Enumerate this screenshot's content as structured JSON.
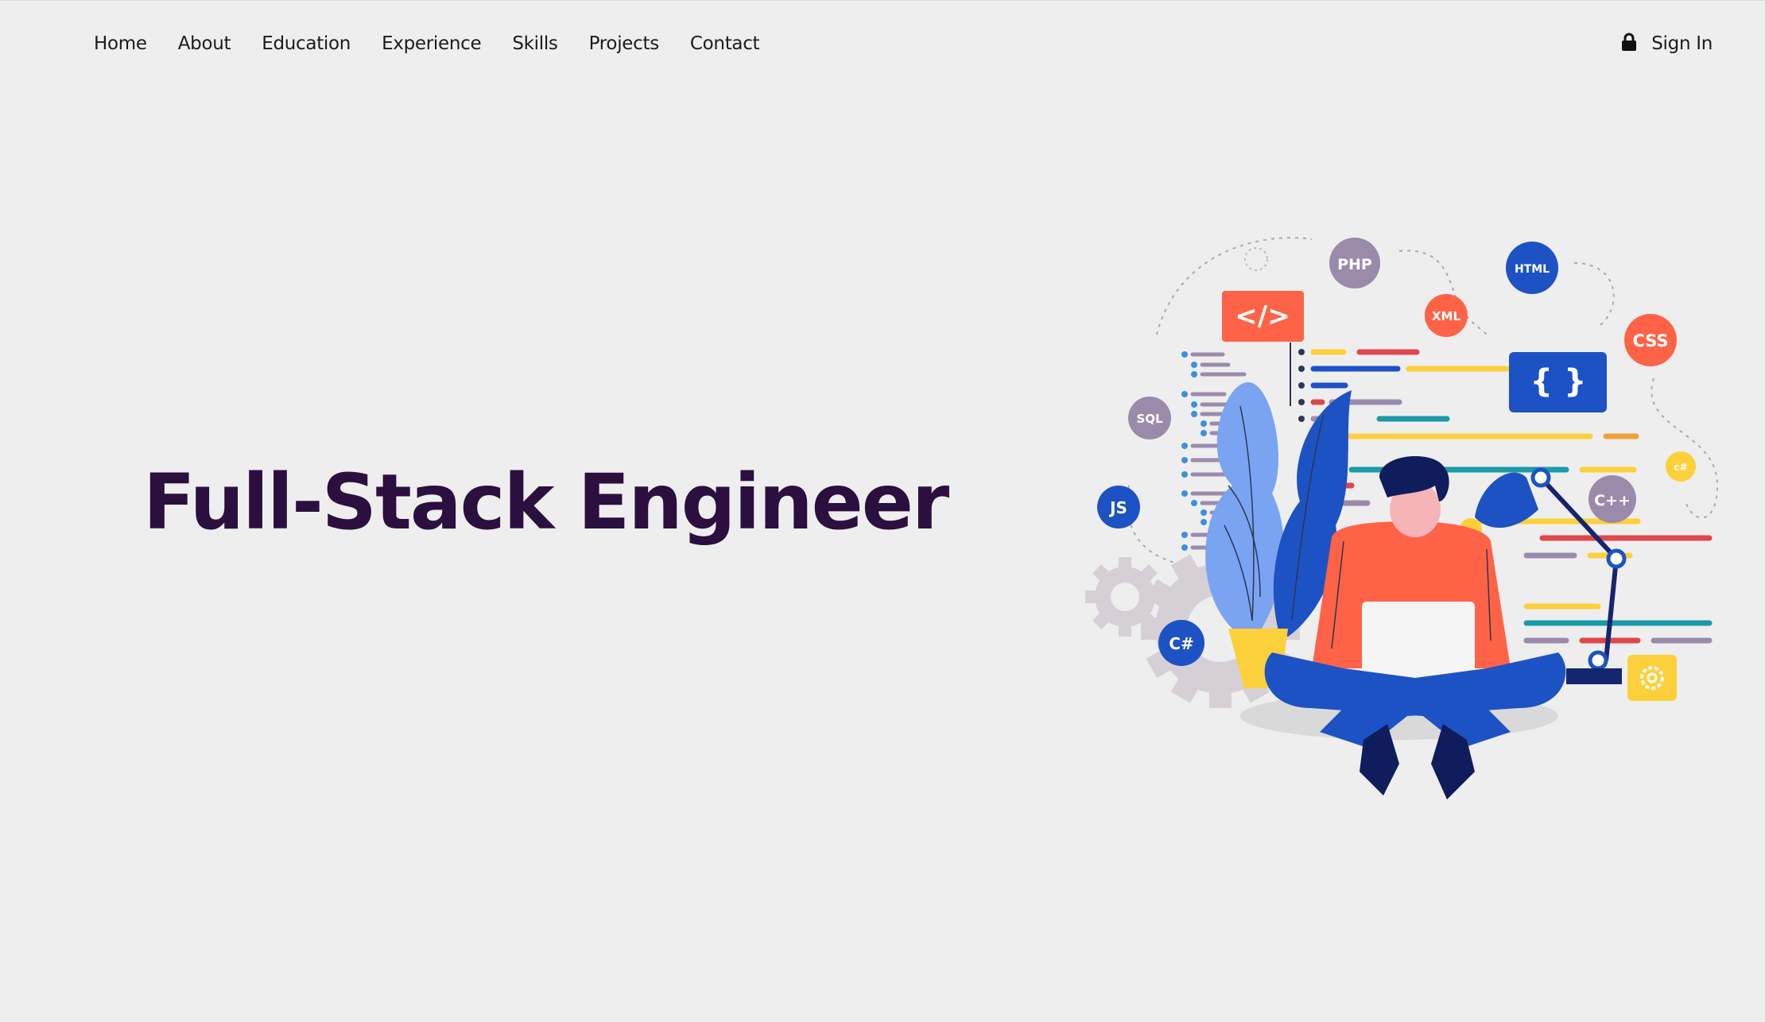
{
  "nav": {
    "items": [
      {
        "label": "Home"
      },
      {
        "label": "About"
      },
      {
        "label": "Education"
      },
      {
        "label": "Experience"
      },
      {
        "label": "Skills"
      },
      {
        "label": "Projects"
      },
      {
        "label": "Contact"
      }
    ],
    "signin": {
      "label": "Sign In",
      "icon": "lock-icon"
    }
  },
  "hero": {
    "title": "Full-Stack Engineer"
  },
  "illustration": {
    "badges": {
      "php": "PHP",
      "html": "HTML",
      "xml": "XML",
      "css": "CSS",
      "sql": "SQL",
      "js": "JS",
      "cpp": "C++",
      "csharp_small": "c#",
      "csharp": "C#",
      "code_tag": "</>",
      "braces": "{ }"
    }
  },
  "colors": {
    "background": "#efeeef",
    "title": "#2a0f3f",
    "nav_text": "#1b1b1b",
    "coral": "#ff6347",
    "blue": "#1d52c4",
    "purple_gray": "#9a8bab",
    "yellow": "#fcd03a"
  }
}
